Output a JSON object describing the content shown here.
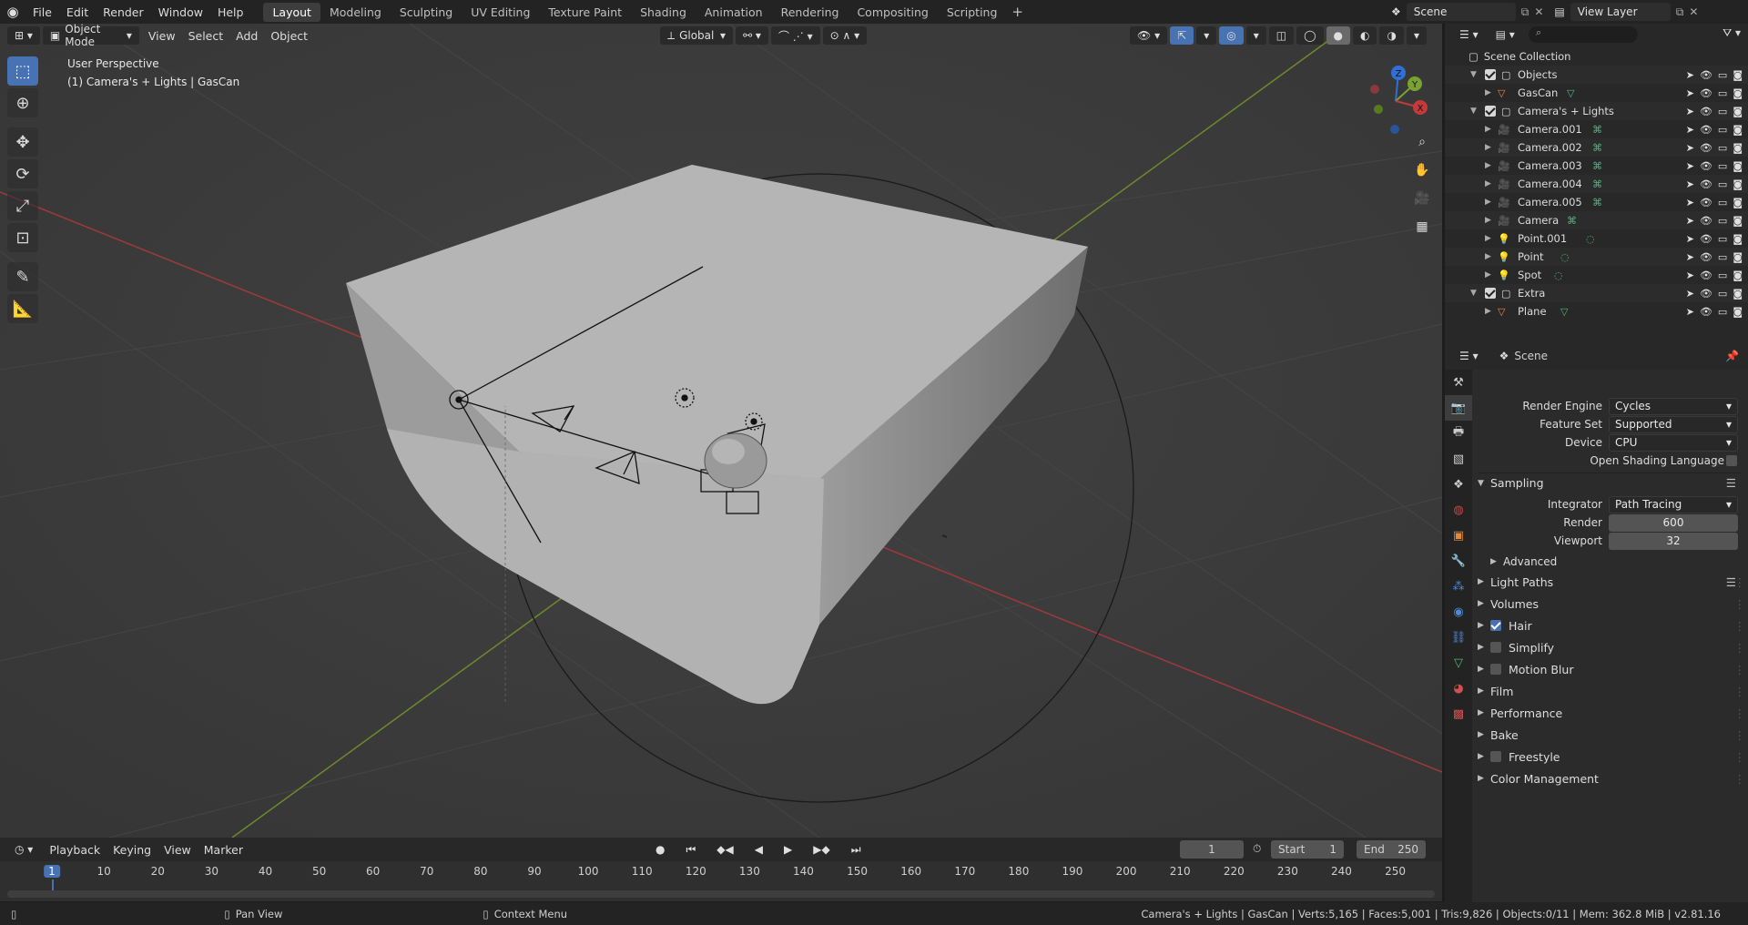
{
  "menu": [
    "File",
    "Edit",
    "Render",
    "Window",
    "Help"
  ],
  "workspaces": [
    "Layout",
    "Modeling",
    "Sculpting",
    "UV Editing",
    "Texture Paint",
    "Shading",
    "Animation",
    "Rendering",
    "Compositing",
    "Scripting"
  ],
  "active_workspace": "Layout",
  "scene_name": "Scene",
  "view_layer": "View Layer",
  "viewport": {
    "mode": "Object Mode",
    "header_menus": [
      "View",
      "Select",
      "Add",
      "Object"
    ],
    "orientation": "Global",
    "info_line1": "User Perspective",
    "info_line2": "(1) Camera's + Lights | GasCan",
    "gizmo_labels": {
      "x": "X",
      "y": "Y",
      "z": "Z"
    }
  },
  "outliner": {
    "root": "Scene Collection",
    "rows": [
      {
        "name": "Objects",
        "kind": "collection",
        "checked": true
      },
      {
        "name": "GasCan",
        "kind": "mesh"
      },
      {
        "name": "Camera's + Lights",
        "kind": "collection",
        "checked": true
      },
      {
        "name": "Camera.001",
        "kind": "camera"
      },
      {
        "name": "Camera.002",
        "kind": "camera"
      },
      {
        "name": "Camera.003",
        "kind": "camera"
      },
      {
        "name": "Camera.004",
        "kind": "camera"
      },
      {
        "name": "Camera.005",
        "kind": "camera"
      },
      {
        "name": "Camera",
        "kind": "camera"
      },
      {
        "name": "Point.001",
        "kind": "light"
      },
      {
        "name": "Point",
        "kind": "light"
      },
      {
        "name": "Spot",
        "kind": "light"
      },
      {
        "name": "Extra",
        "kind": "collection",
        "checked": true
      },
      {
        "name": "Plane",
        "kind": "mesh"
      }
    ]
  },
  "properties": {
    "context": "Scene",
    "render_engine_label": "Render Engine",
    "render_engine": "Cycles",
    "feature_set_label": "Feature Set",
    "feature_set": "Supported",
    "device_label": "Device",
    "device": "CPU",
    "osl_label": "Open Shading Language",
    "sampling": "Sampling",
    "integrator_label": "Integrator",
    "integrator": "Path Tracing",
    "render_label": "Render",
    "render_samples": "600",
    "viewport_label": "Viewport",
    "viewport_samples": "32",
    "advanced": "Advanced",
    "sections": [
      {
        "label": "Light Paths",
        "checkbox": null
      },
      {
        "label": "Volumes",
        "checkbox": null
      },
      {
        "label": "Hair",
        "checkbox": true
      },
      {
        "label": "Simplify",
        "checkbox": false
      },
      {
        "label": "Motion Blur",
        "checkbox": false
      },
      {
        "label": "Film",
        "checkbox": null
      },
      {
        "label": "Performance",
        "checkbox": null
      },
      {
        "label": "Bake",
        "checkbox": null
      },
      {
        "label": "Freestyle",
        "checkbox": false
      },
      {
        "label": "Color Management",
        "checkbox": null
      }
    ]
  },
  "timeline": {
    "menus": [
      "Playback",
      "Keying",
      "View",
      "Marker"
    ],
    "current_frame": "1",
    "start_label": "Start",
    "start": "1",
    "end_label": "End",
    "end": "250",
    "ticks": [
      "1",
      "10",
      "20",
      "30",
      "40",
      "50",
      "60",
      "70",
      "80",
      "90",
      "100",
      "110",
      "120",
      "130",
      "140",
      "150",
      "160",
      "170",
      "180",
      "190",
      "200",
      "210",
      "220",
      "230",
      "240",
      "250"
    ]
  },
  "status": {
    "pan": "Pan View",
    "context_menu": "Context Menu",
    "stats": "Camera's + Lights | GasCan | Verts:5,165 | Faces:5,001 | Tris:9,826 | Objects:0/11 | Mem: 362.8 MiB | v2.81.16"
  },
  "colors": {
    "accent": "#4772b3",
    "x_axis": "#c23a3a",
    "y_axis": "#7aa232",
    "z_axis": "#2f6fd8",
    "camera_icon": "#e08a3c",
    "data_icon": "#4fb87b"
  }
}
